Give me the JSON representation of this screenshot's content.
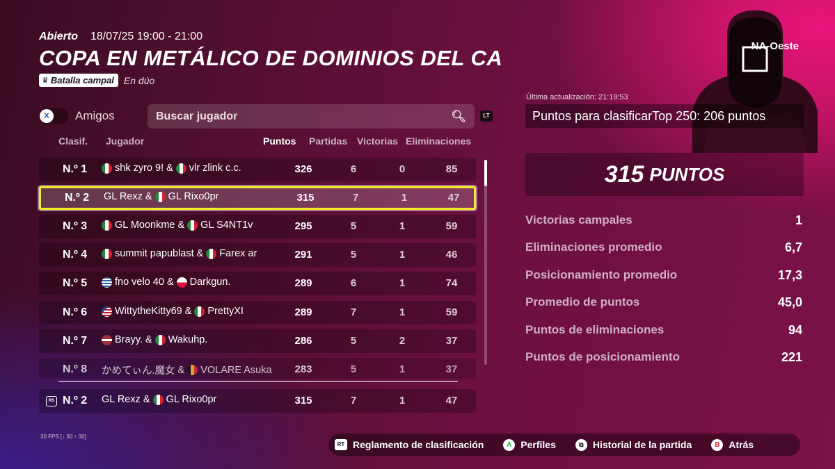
{
  "event": {
    "status": "Abierto",
    "datetime": "18/07/25 19:00 - 21:00",
    "title": "COPA EN METÁLICO DE DOMINIOS DEL CA",
    "mode": "Batalla campal",
    "mode_sub": "En dúo",
    "region": "NA-Oeste"
  },
  "controls": {
    "friends_label": "Amigos",
    "friends_button": "X",
    "search_placeholder": "Buscar jugador",
    "search_button": "LT"
  },
  "table": {
    "headers": {
      "rank": "Clasif.",
      "player": "Jugador",
      "points": "Puntos",
      "matches": "Partidas",
      "wins": "Victorias",
      "elims": "Eliminaciones"
    },
    "rows": [
      {
        "rank": "N.º 1",
        "p1": "shk zyro 9!",
        "p2": "vlr zlink c.c.",
        "points": "326",
        "matches": "6",
        "wins": "0",
        "elims": "85"
      },
      {
        "rank": "N.º 2",
        "p1": "GL Rexz",
        "p2": "GL Rixo0pr",
        "points": "315",
        "matches": "7",
        "wins": "1",
        "elims": "47"
      },
      {
        "rank": "N.º 3",
        "p1": "GL Moonkme",
        "p2": "GL S4NT1v",
        "points": "295",
        "matches": "5",
        "wins": "1",
        "elims": "59"
      },
      {
        "rank": "N.º 4",
        "p1": "summit papublast",
        "p2": "Farex ar",
        "points": "291",
        "matches": "5",
        "wins": "1",
        "elims": "46"
      },
      {
        "rank": "N.º 5",
        "p1": "fno velo 40",
        "p2": "Darkgun.",
        "points": "289",
        "matches": "6",
        "wins": "1",
        "elims": "74"
      },
      {
        "rank": "N.º 6",
        "p1": "WittytheKitty69",
        "p2": "PrettyXI",
        "points": "289",
        "matches": "7",
        "wins": "1",
        "elims": "59"
      },
      {
        "rank": "N.º 7",
        "p1": "Brayy.",
        "p2": "Wakuhp.",
        "points": "286",
        "matches": "5",
        "wins": "2",
        "elims": "37"
      },
      {
        "rank": "N.º 8",
        "p1": "かめてぃん.魔女",
        "p2": "VOLARE Asuka",
        "points": "283",
        "matches": "5",
        "wins": "1",
        "elims": "37"
      }
    ],
    "my_row": {
      "rank": "N.º 2",
      "p1": "GL Rexz",
      "p2": "GL Rixo0pr",
      "points": "315",
      "matches": "7",
      "wins": "1",
      "elims": "47",
      "icon_text": "RS"
    },
    "selected_index": 1,
    "flags": [
      "mexico-flag",
      "greece-flag",
      "poland-flag",
      "usa-flag",
      "latvia-flag",
      "belgium-flag"
    ]
  },
  "summary": {
    "updated": "Última actualización: 21:19:53",
    "qualify_label": "Puntos para clasificar",
    "qualify_value": "Top 250: 206 puntos",
    "score": "315",
    "score_unit": "PUNTOS",
    "stats": [
      {
        "label": "Victorias campales",
        "value": "1"
      },
      {
        "label": "Eliminaciones promedio",
        "value": "6,7"
      },
      {
        "label": "Posicionamiento promedio",
        "value": "17,3"
      },
      {
        "label": "Promedio de puntos",
        "value": "45,0"
      },
      {
        "label": "Puntos de eliminaciones",
        "value": "94"
      },
      {
        "label": "Puntos de posicionamiento",
        "value": "221"
      }
    ]
  },
  "footer": {
    "fps": "30 FPS [↓ 30 ↑ 30]",
    "actions": [
      {
        "button": "RT",
        "label": "Reglamento de clasificación"
      },
      {
        "button": "A",
        "label": "Perfiles"
      },
      {
        "button": "View",
        "label": "Historial de la partida"
      },
      {
        "button": "B",
        "label": "Atrás"
      }
    ]
  },
  "colors": {
    "highlight": "#f3eb2a",
    "accent_pink": "#e8157a",
    "mexico": "#1d8b3a",
    "button_a": "#2bb24c",
    "button_b": "#e0283c"
  }
}
